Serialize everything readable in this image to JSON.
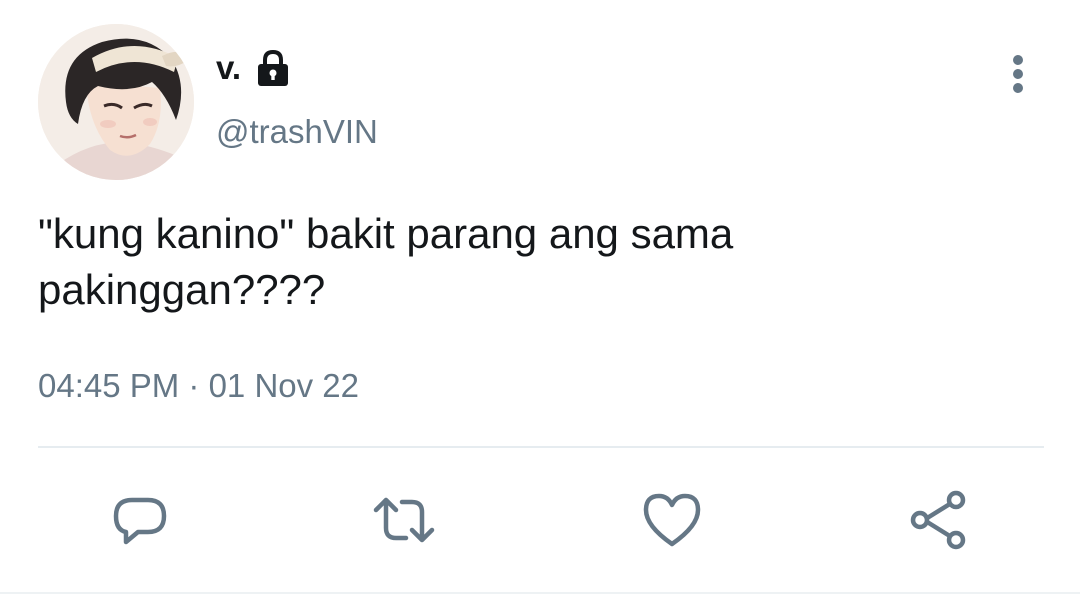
{
  "tweet": {
    "display_name": "v.",
    "handle": "@trashVIN",
    "text": "\"kung kanino\" bakit parang ang sama\npakinggan????",
    "timestamp": "04:45 PM · 01 Nov 22"
  },
  "icons": {
    "header": [
      "lock-icon",
      "more-vertical-icon"
    ],
    "actions": [
      "reply-icon",
      "retweet-icon",
      "like-icon",
      "share-icon"
    ]
  },
  "colors": {
    "text": "#14171a",
    "secondary": "#657786",
    "divider": "#e6ecf0"
  }
}
